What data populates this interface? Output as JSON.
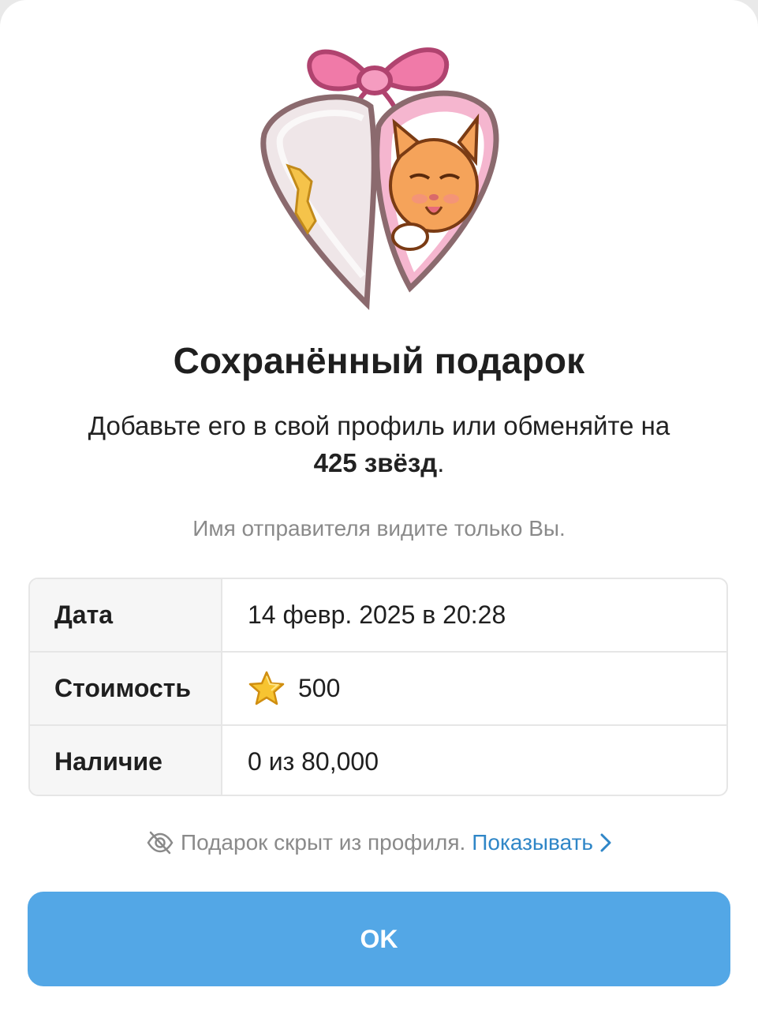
{
  "gift": {
    "image_icon": "heart-locket-cat-icon"
  },
  "header": {
    "title": "Сохранённый подарок"
  },
  "description": {
    "prefix": "Добавьте его в свой профиль или обменяйте на ",
    "stars_amount": "425 звёзд",
    "suffix": "."
  },
  "note": "Имя отправителя видите только Вы.",
  "details": [
    {
      "label": "Дата",
      "value": "14 февр. 2025 в 20:28"
    },
    {
      "label": "Стоимость",
      "value": "500",
      "icon": "star-icon"
    },
    {
      "label": "Наличие",
      "value": "0 из 80,000"
    }
  ],
  "visibility": {
    "icon": "eye-off-icon",
    "text": "Подарок скрыт из профиля.",
    "link": "Показывать"
  },
  "ok_button": "OK",
  "colors": {
    "accent": "#53a7e6",
    "link": "#2f86c7"
  }
}
